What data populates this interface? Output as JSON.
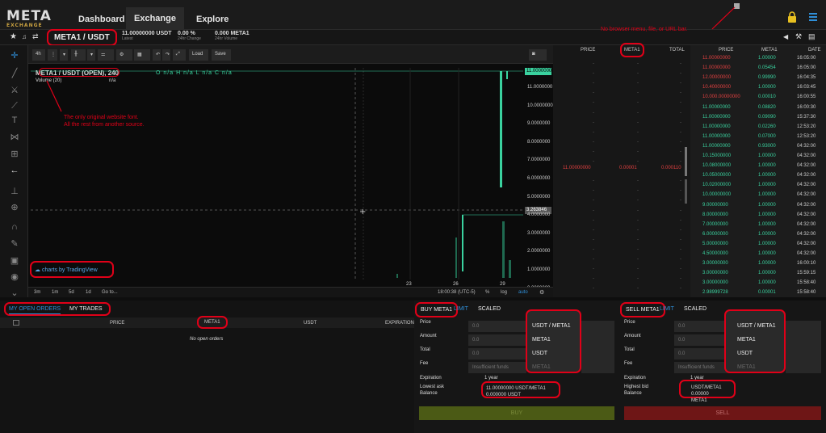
{
  "app": {
    "logo": "META",
    "logo_sub": "EXCHANGE",
    "nav": [
      "Dashboard",
      "Exchange",
      "Explore"
    ]
  },
  "header": {
    "pair": "META1 / USDT",
    "latest_value": "11.00000000 USDT",
    "latest_label": "Latest",
    "change_value": "0.00 %",
    "change_label": "24hr Change",
    "volume_value": "0.000 META1",
    "volume_label": "24hr Volume"
  },
  "annotations": {
    "browser": "No browser menu, file, or URL bar.",
    "font_line1": "The only original website font.",
    "font_line2": "All the rest from another source."
  },
  "chart": {
    "toolbar": {
      "interval": "4h",
      "load": "Load",
      "save": "Save"
    },
    "legend_pair": "META1 / USDT (OPEN), 240",
    "legend_ohlc": "O n/a  H n/a  L n/a  C n/a",
    "volume_label": "Volume (20)",
    "volume_value": "n/a",
    "watermark": "charts by TradingView",
    "y_ticks": [
      "11.0000000",
      "10.0000000",
      "9.0000000",
      "8.0000000",
      "7.0000000",
      "6.0000000",
      "5.0000000",
      "4.0000000",
      "3.0000000",
      "2.0000000",
      "1.0000000",
      "0.0000000"
    ],
    "current_tag": "11.0000000",
    "cross_tag": "3.263846",
    "x_ticks": [
      "23",
      "26",
      "29"
    ],
    "ranges": [
      "3m",
      "1m",
      "5d",
      "1d",
      "Go to..."
    ],
    "footer": {
      "time": "18:00:38 (UTC-5)",
      "pct": "%",
      "log": "log",
      "auto": "auto"
    }
  },
  "orderbook": {
    "headers": [
      "PRICE",
      "META1",
      "TOTAL"
    ],
    "row": {
      "price": "11.00000000",
      "amount": "0.00001",
      "total": "0.000110"
    }
  },
  "trades": {
    "headers": [
      "PRICE",
      "META1",
      "DATE"
    ],
    "rows": [
      [
        "11.00000000",
        "1.00000",
        "16:05:00"
      ],
      [
        "11.00000000",
        "0.05454",
        "16:05:00"
      ],
      [
        "12.00000000",
        "0.99990",
        "16:04:35"
      ],
      [
        "10.40000000",
        "1.00000",
        "16:03:45"
      ],
      [
        "10.000.00000000",
        "0.00010",
        "16:00:55"
      ],
      [
        "11.00000000",
        "0.08820",
        "16:00:30"
      ],
      [
        "11.00000000",
        "0.09090",
        "15:37:30"
      ],
      [
        "11.00000000",
        "0.02260",
        "12:53:20"
      ],
      [
        "11.00000000",
        "0.07000",
        "12:53:20"
      ],
      [
        "11.00000000",
        "0.93000",
        "04:32:00"
      ],
      [
        "10.15000000",
        "1.00000",
        "04:32:00"
      ],
      [
        "10.08000000",
        "1.00000",
        "04:32:00"
      ],
      [
        "10.05000000",
        "1.00000",
        "04:32:00"
      ],
      [
        "10.02000000",
        "1.00000",
        "04:32:00"
      ],
      [
        "10.00000000",
        "1.00000",
        "04:32:00"
      ],
      [
        "9.00000000",
        "1.00000",
        "04:32:00"
      ],
      [
        "8.00000000",
        "1.00000",
        "04:32:00"
      ],
      [
        "7.00000000",
        "1.00000",
        "04:32:00"
      ],
      [
        "6.00000000",
        "1.00000",
        "04:32:00"
      ],
      [
        "5.00000000",
        "1.00000",
        "04:32:00"
      ],
      [
        "4.50000000",
        "1.00000",
        "04:32:00"
      ],
      [
        "3.00000000",
        "1.00000",
        "16:00:10"
      ],
      [
        "3.00000000",
        "1.00000",
        "15:59:15"
      ],
      [
        "3.00000000",
        "1.00000",
        "15:58:40"
      ],
      [
        "2.98999728",
        "0.00001",
        "15:58:40"
      ]
    ]
  },
  "orders": {
    "tab_open": "MY OPEN ORDERS",
    "tab_trades": "MY TRADES",
    "headers": [
      "PRICE",
      "META1",
      "USDT",
      "EXPIRATION"
    ],
    "empty": "No open orders"
  },
  "buy": {
    "tab": "BUY META1",
    "limit": "LIMIT",
    "scaled": "SCALED",
    "labels": [
      "Price",
      "Amount",
      "Total",
      "Fee"
    ],
    "price_val": "0.0",
    "amount_val": "0.0",
    "total_val": "0.0",
    "fee_val": "Insufficient funds",
    "units": [
      "USDT / META1",
      "META1",
      "USDT",
      "META1"
    ],
    "expiration_label": "Expiration",
    "expiration_val": "1 year",
    "ask_label": "Lowest ask",
    "ask_val": "11.00000000 USDT/META1",
    "balance_label": "Balance",
    "balance_val": "0.000000 USDT",
    "button": "BUY"
  },
  "sell": {
    "tab": "SELL META1",
    "limit": "LIMIT",
    "scaled": "SCALED",
    "labels": [
      "Price",
      "Amount",
      "Total",
      "Fee"
    ],
    "price_val": "0.0",
    "amount_val": "0.0",
    "total_val": "0.0",
    "fee_val": "Insufficient funds",
    "units": [
      "USDT / META1",
      "META1",
      "USDT",
      "META1"
    ],
    "expiration_label": "Expiration",
    "expiration_val": "1 year",
    "bid_label": "Highest bid",
    "bid_val": "USDT/META1",
    "balance_label": "Balance",
    "balance_val": "0.00000 META1",
    "button": "SELL"
  },
  "colors": {
    "buy_button": "#4b5a15",
    "sell_button": "#6e1616",
    "up": "#3ad29f",
    "ask": "#e04040",
    "accent_blue": "#2f8fd8"
  }
}
